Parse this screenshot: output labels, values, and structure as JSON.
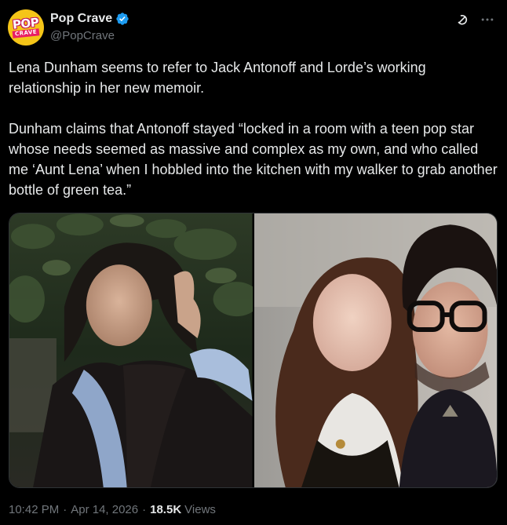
{
  "author": {
    "display_name": "Pop Crave",
    "handle": "@PopCrave",
    "avatar_text_top": "POP",
    "avatar_text_bottom": "CRAVE",
    "verified": true
  },
  "header_icons": {
    "grok": "grok-icon",
    "more": "more-icon"
  },
  "tweet": {
    "paragraph_1": "Lena Dunham seems to refer to Jack Antonoff and Lorde’s working relationship in her new memoir.",
    "paragraph_2": "Dunham claims that Antonoff stayed “locked in a room with a teen pop star whose needs seemed as massive and complex as my own, and who called me ‘Aunt Lena’ when I hobbled into the kitchen with my walker to grab another bottle of green tea.”"
  },
  "media": {
    "count": 2
  },
  "meta": {
    "time": "10:42 PM",
    "separator": "·",
    "date": "Apr 14, 2026",
    "views_count": "18.5K",
    "views_label": "Views"
  },
  "colors": {
    "background": "#000000",
    "text": "#e7e9ea",
    "secondary": "#71767b",
    "verified": "#1d9bf0",
    "avatar_bg": "#f5c518"
  }
}
